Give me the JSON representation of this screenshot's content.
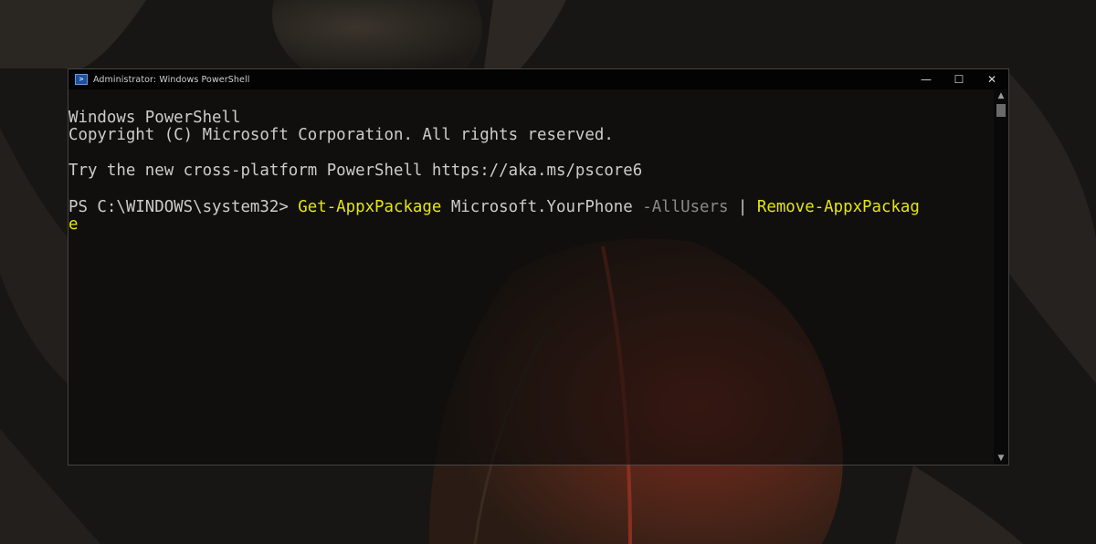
{
  "window": {
    "title": "Administrator: Windows PowerShell",
    "controls": {
      "minimize": "—",
      "maximize": "☐",
      "close": "✕"
    }
  },
  "console": {
    "banner_line1": "Windows PowerShell",
    "banner_line2": "Copyright (C) Microsoft Corporation. All rights reserved.",
    "tip_line": "Try the new cross-platform PowerShell https://aka.ms/pscore6",
    "prompt": "PS C:\\WINDOWS\\system32> ",
    "cmd_name": "Get-AppxPackage",
    "cmd_arg": " Microsoft.YourPhone ",
    "cmd_param": "-AllUsers",
    "pipe": " | ",
    "cmd2_part1": "Remove-AppxPackag",
    "cmd2_part2": "e"
  },
  "scrollbar": {
    "up_icon": "chevron-up-icon",
    "down_icon": "chevron-down-icon"
  },
  "colors": {
    "console_text": "#cccccc",
    "cmdlet": "#e5e510",
    "parameter": "#8a8a8a"
  }
}
